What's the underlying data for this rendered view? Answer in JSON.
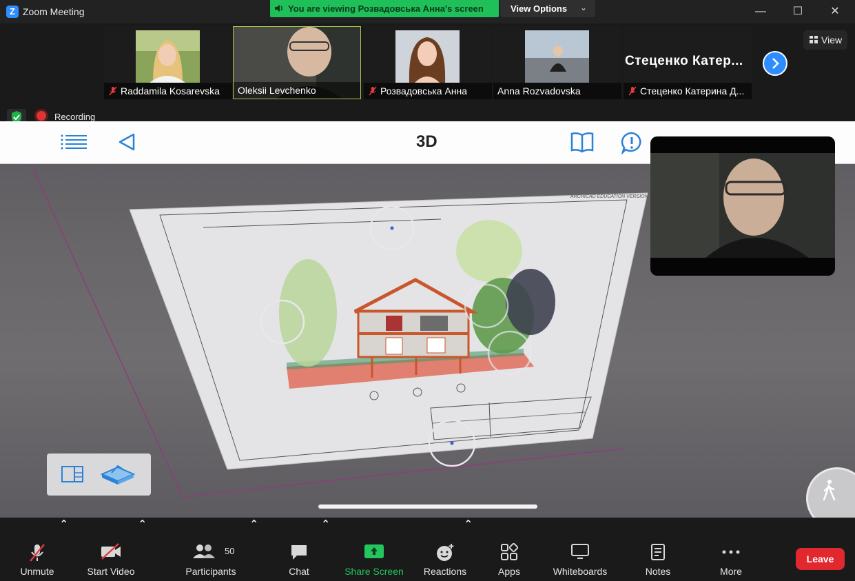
{
  "window": {
    "title": "Zoom Meeting",
    "logo_letter": "Z"
  },
  "banner": {
    "text": "You are viewing Розвадовська Анна's screen",
    "view_options_label": "View Options"
  },
  "participants_strip": [
    {
      "name": "Raddamila Kosarevska",
      "muted": true
    },
    {
      "name": "Oleksii Levchenko",
      "muted": false,
      "active_speaker": true
    },
    {
      "name": "Розвадовська Анна",
      "muted": true
    },
    {
      "name": "Anna Rozvadovska",
      "muted": false
    },
    {
      "name": "Стеценко Катерина Д...",
      "display_name": "Стеценко  Катер...",
      "muted": true
    }
  ],
  "view_button_label": "View",
  "recording_label": "Recording",
  "shared_app": {
    "title": "3D",
    "watermark": "ARCHICAD EDUCATION VERSION"
  },
  "toolbar": {
    "unmute": "Unmute",
    "start_video": "Start Video",
    "participants": "Participants",
    "participants_count": "50",
    "chat": "Chat",
    "share_screen": "Share Screen",
    "reactions": "Reactions",
    "apps": "Apps",
    "whiteboards": "Whiteboards",
    "notes": "Notes",
    "more": "More",
    "leave": "Leave"
  },
  "colors": {
    "zoom_blue": "#2d8cff",
    "banner_green": "#1fbf5a",
    "share_green": "#22c55e",
    "leave_red": "#e0282e",
    "app_accent_blue": "#2a82d6"
  }
}
